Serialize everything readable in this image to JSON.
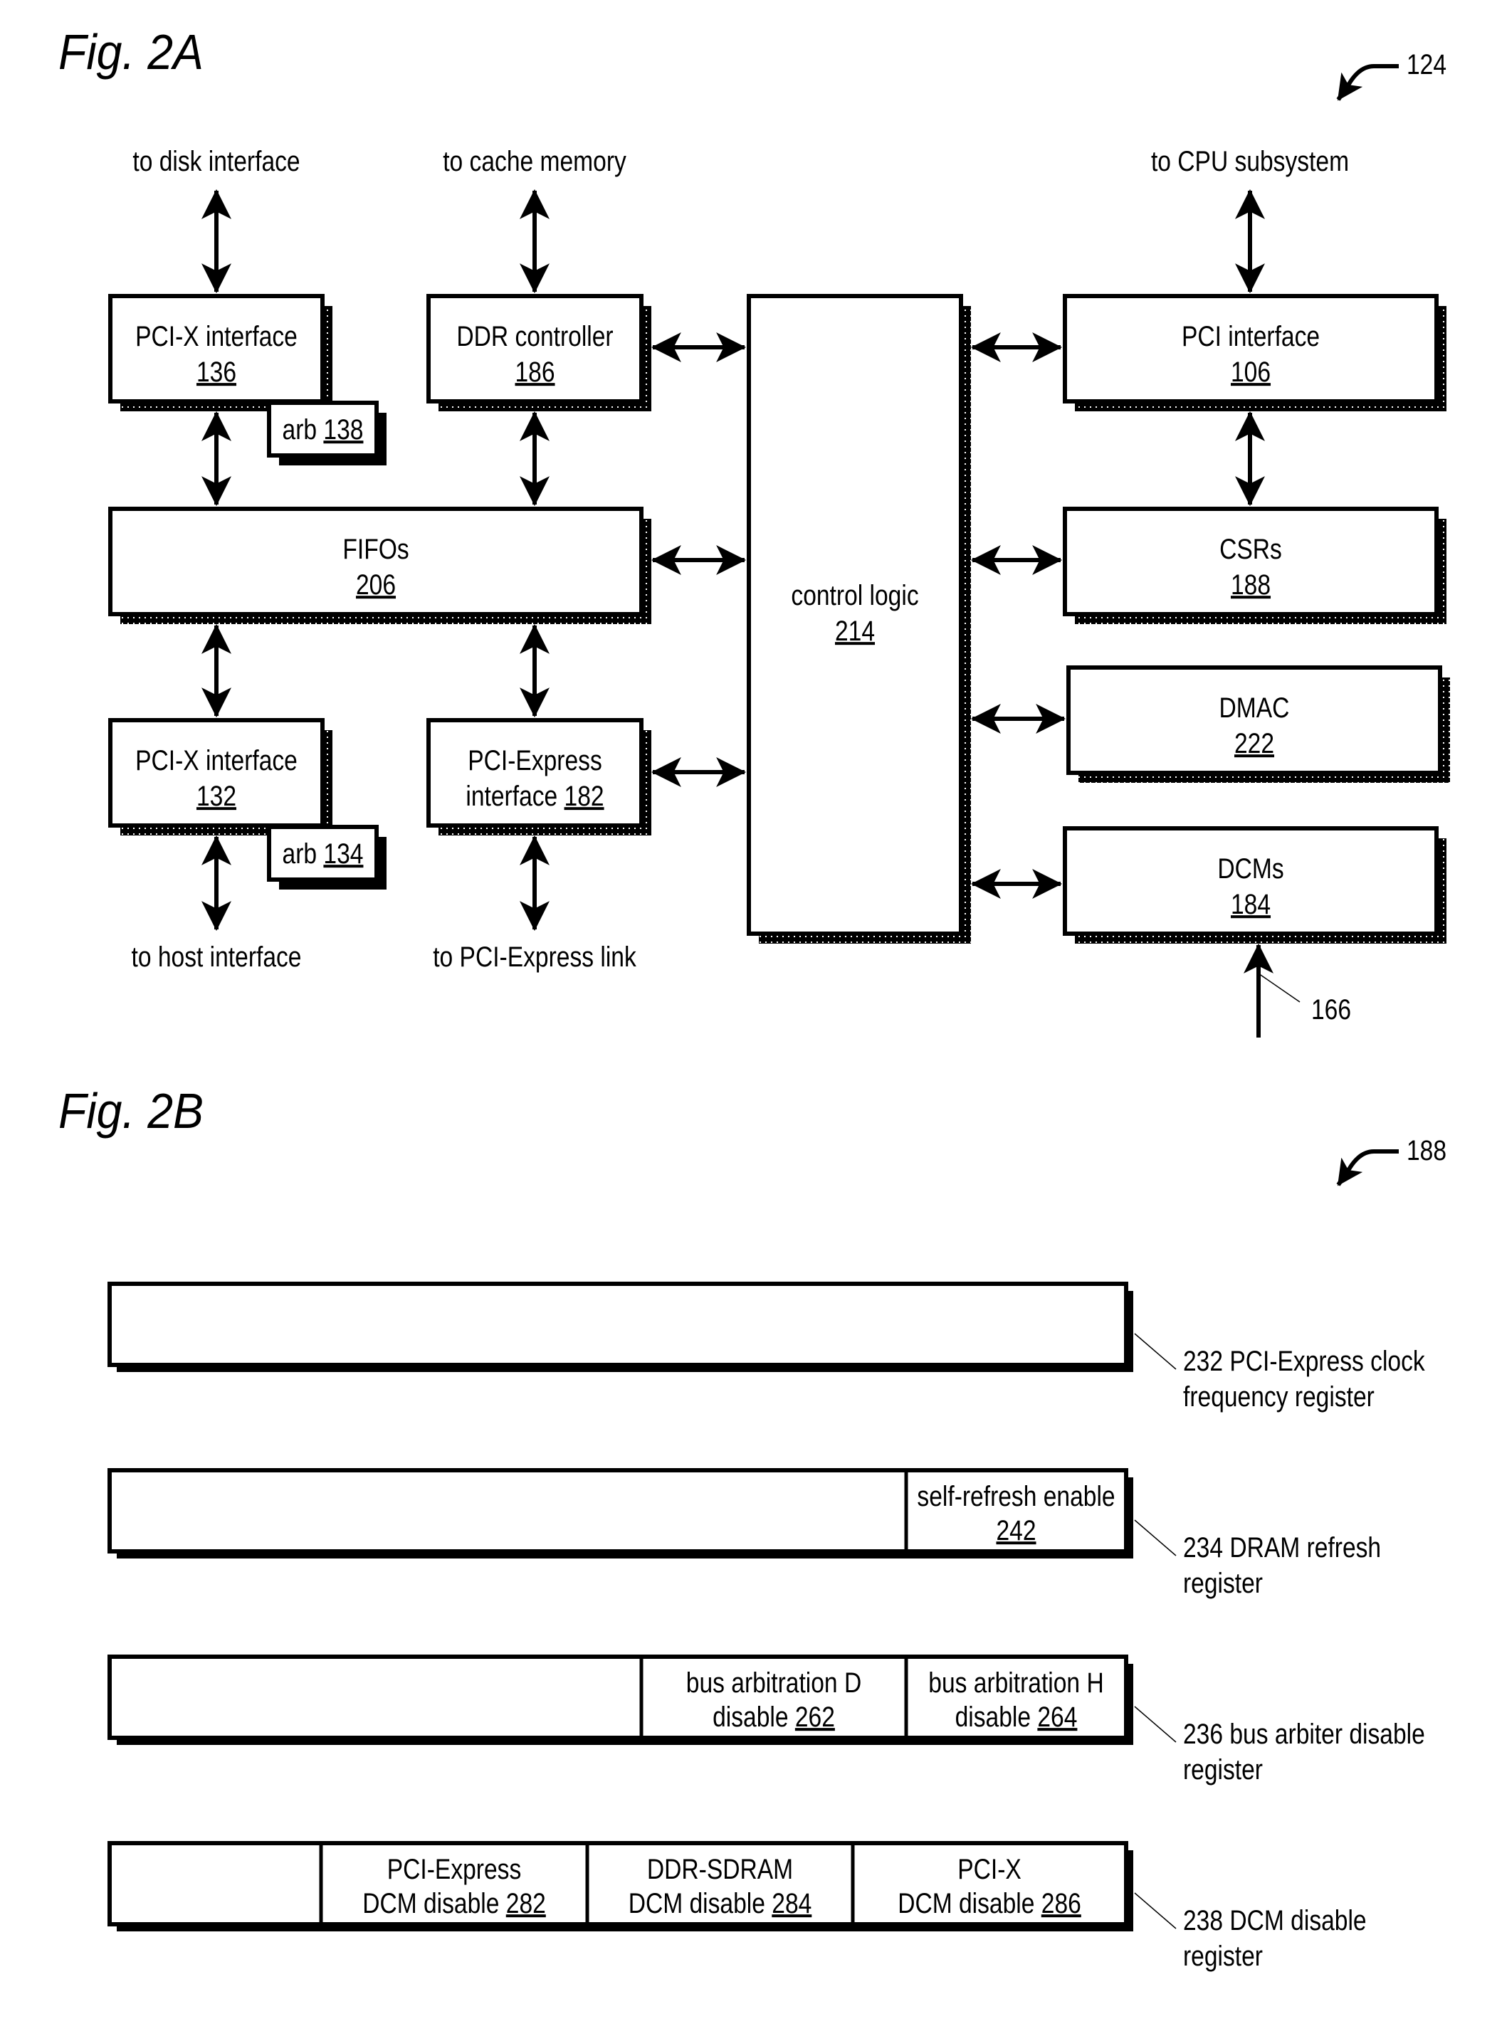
{
  "figures": {
    "fig2a": {
      "title": "Fig. 2A",
      "ref_label": "124",
      "external_labels": {
        "disk": "to disk interface",
        "cache": "to cache memory",
        "cpu": "to CPU subsystem",
        "host": "to host interface",
        "pcie_link": "to PCI-Express link"
      },
      "blocks": {
        "pcix136": {
          "name": "PCI-X interface",
          "ref": "136"
        },
        "arb138": {
          "name": "arb",
          "ref": "138"
        },
        "ddr186": {
          "name": "DDR controller",
          "ref": "186"
        },
        "fifos206": {
          "name": "FIFOs",
          "ref": "206"
        },
        "pcix132": {
          "name": "PCI-X interface",
          "ref": "132"
        },
        "arb134": {
          "name": "arb",
          "ref": "134"
        },
        "pcie182": {
          "name_line1": "PCI-Express",
          "name_line2": "interface",
          "ref": "182"
        },
        "control214": {
          "name": "control logic",
          "ref": "214"
        },
        "pci106": {
          "name": "PCI interface",
          "ref": "106"
        },
        "csrs188": {
          "name": "CSRs",
          "ref": "188"
        },
        "dmac222": {
          "name": "DMAC",
          "ref": "222"
        },
        "dcms184": {
          "name": "DCMs",
          "ref": "184"
        }
      },
      "signal_label": "166"
    },
    "fig2b": {
      "title": "Fig. 2B",
      "ref_label": "188",
      "registers": [
        {
          "id": "232",
          "caption_line1": "232 PCI-Express clock",
          "caption_line2": "frequency register",
          "fields": []
        },
        {
          "id": "234",
          "caption_line1": "234 DRAM refresh",
          "caption_line2": "register",
          "fields": [
            {
              "line1": "self-refresh enable",
              "line2_prefix": "",
              "ref": "242"
            }
          ]
        },
        {
          "id": "236",
          "caption_line1": "236 bus arbiter disable",
          "caption_line2": "register",
          "fields": [
            {
              "line1": "bus arbitration D",
              "line2_prefix": "disable ",
              "ref": "262"
            },
            {
              "line1": "bus arbitration H",
              "line2_prefix": "disable ",
              "ref": "264"
            }
          ]
        },
        {
          "id": "238",
          "caption_line1": "238 DCM disable",
          "caption_line2": "register",
          "fields": [
            {
              "line1": "PCI-Express",
              "line2_prefix": "DCM disable ",
              "ref": "282"
            },
            {
              "line1": "DDR-SDRAM",
              "line2_prefix": "DCM disable ",
              "ref": "284"
            },
            {
              "line1": "PCI-X",
              "line2_prefix": "DCM disable ",
              "ref": "286"
            }
          ]
        }
      ]
    }
  }
}
